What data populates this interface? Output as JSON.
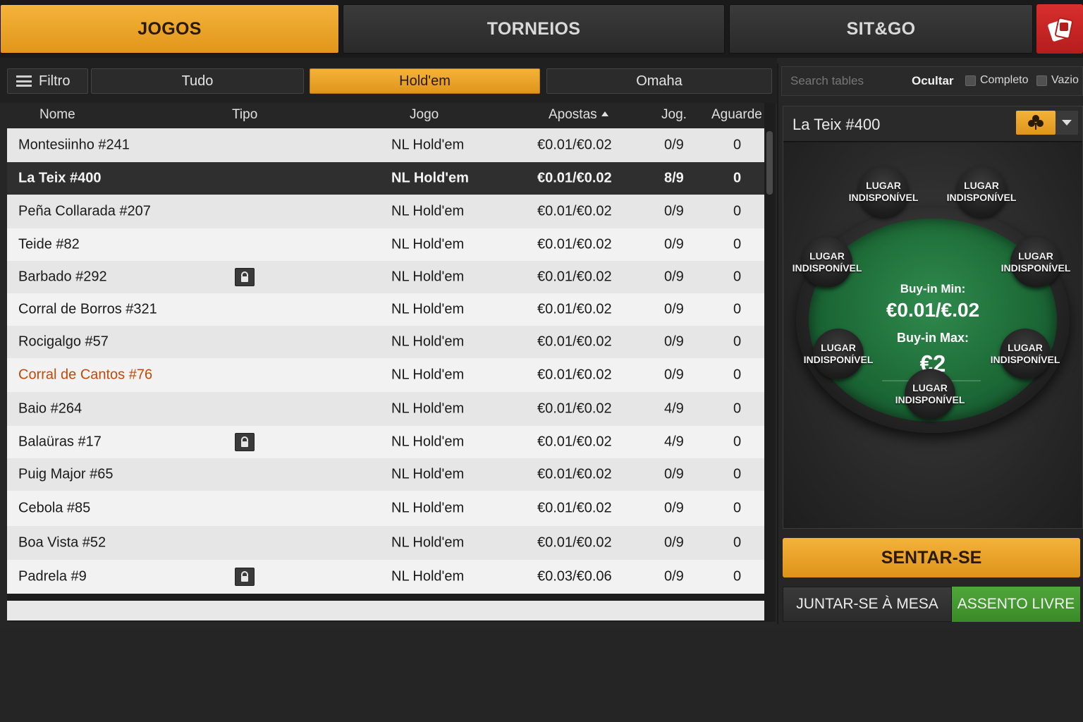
{
  "top_tabs": [
    {
      "label": "JOGOS",
      "active": true
    },
    {
      "label": "TORNEIOS",
      "active": false
    },
    {
      "label": "SIT&GO",
      "active": false
    }
  ],
  "filters": {
    "filtro_label": "Filtro",
    "options": [
      "Tudo",
      "Hold'em",
      "Omaha"
    ],
    "active": "Hold'em"
  },
  "columns": {
    "nome": "Nome",
    "tipo": "Tipo",
    "jogo": "Jogo",
    "apostas": "Apostas",
    "jog": "Jog.",
    "aguarde": "Aguarde"
  },
  "rows": [
    {
      "nome": "Montesiinho #241",
      "locked": false,
      "jogo": "NL Hold'em",
      "apostas": "€0.01/€0.02",
      "jog": "0/9",
      "aguarde": "0"
    },
    {
      "nome": "La Teix #400",
      "locked": false,
      "jogo": "NL Hold'em",
      "apostas": "€0.01/€0.02",
      "jog": "8/9",
      "aguarde": "0",
      "selected": true
    },
    {
      "nome": "Peña Collarada #207",
      "locked": false,
      "jogo": "NL Hold'em",
      "apostas": "€0.01/€0.02",
      "jog": "0/9",
      "aguarde": "0"
    },
    {
      "nome": "Teide #82",
      "locked": false,
      "jogo": "NL Hold'em",
      "apostas": "€0.01/€0.02",
      "jog": "0/9",
      "aguarde": "0"
    },
    {
      "nome": "Barbado #292",
      "locked": true,
      "jogo": "NL Hold'em",
      "apostas": "€0.01/€0.02",
      "jog": "0/9",
      "aguarde": "0"
    },
    {
      "nome": "Corral de Borros #321",
      "locked": false,
      "jogo": "NL Hold'em",
      "apostas": "€0.01/€0.02",
      "jog": "0/9",
      "aguarde": "0"
    },
    {
      "nome": "Rocigalgo #57",
      "locked": false,
      "jogo": "NL Hold'em",
      "apostas": "€0.01/€0.02",
      "jog": "0/9",
      "aguarde": "0"
    },
    {
      "nome": "Corral de Cantos #76",
      "locked": false,
      "jogo": "NL Hold'em",
      "apostas": "€0.01/€0.02",
      "jog": "0/9",
      "aguarde": "0",
      "highlight": true
    },
    {
      "nome": "Baio #264",
      "locked": false,
      "jogo": "NL Hold'em",
      "apostas": "€0.01/€0.02",
      "jog": "4/9",
      "aguarde": "0"
    },
    {
      "nome": "Balaüras #17",
      "locked": true,
      "jogo": "NL Hold'em",
      "apostas": "€0.01/€0.02",
      "jog": "4/9",
      "aguarde": "0"
    },
    {
      "nome": "Puig Major #65",
      "locked": false,
      "jogo": "NL Hold'em",
      "apostas": "€0.01/€0.02",
      "jog": "0/9",
      "aguarde": "0"
    },
    {
      "nome": "Cebola #85",
      "locked": false,
      "jogo": "NL Hold'em",
      "apostas": "€0.01/€0.02",
      "jog": "0/9",
      "aguarde": "0"
    },
    {
      "nome": "Boa Vista #52",
      "locked": false,
      "jogo": "NL Hold'em",
      "apostas": "€0.01/€0.02",
      "jog": "0/9",
      "aguarde": "0"
    },
    {
      "nome": "Padrela #9",
      "locked": true,
      "jogo": "NL Hold'em",
      "apostas": "€0.03/€0.06",
      "jog": "0/9",
      "aguarde": "0"
    }
  ],
  "search": {
    "placeholder": "Search tables",
    "ocultar_label": "Ocultar",
    "completo_label": "Completo",
    "vazio_label": "Vazio"
  },
  "detail": {
    "title": "La Teix #400",
    "buyin_min_label": "Buy-in Min:",
    "buyin_min_value": "€0.01/€.02",
    "buyin_max_label": "Buy-in Max:",
    "buyin_max_value": "€2",
    "seat_line1": "LUGAR",
    "seat_line2": "INDISPONÍVEL"
  },
  "actions": {
    "sentar": "SENTAR-SE",
    "juntar": "JUNTAR-SE À MESA",
    "assento": "ASSENTO LIVRE"
  },
  "colors": {
    "accent": "#f0a72c",
    "green": "#46a034",
    "highlight_text": "#c04a07",
    "logo_red": "#d12a2a"
  },
  "icons": {
    "corner_logo": "cards-logo-icon",
    "filtro": "hamburger-icon",
    "lock": "lock-icon",
    "view": "clover-icon",
    "dropdown": "chevron-down-icon"
  }
}
